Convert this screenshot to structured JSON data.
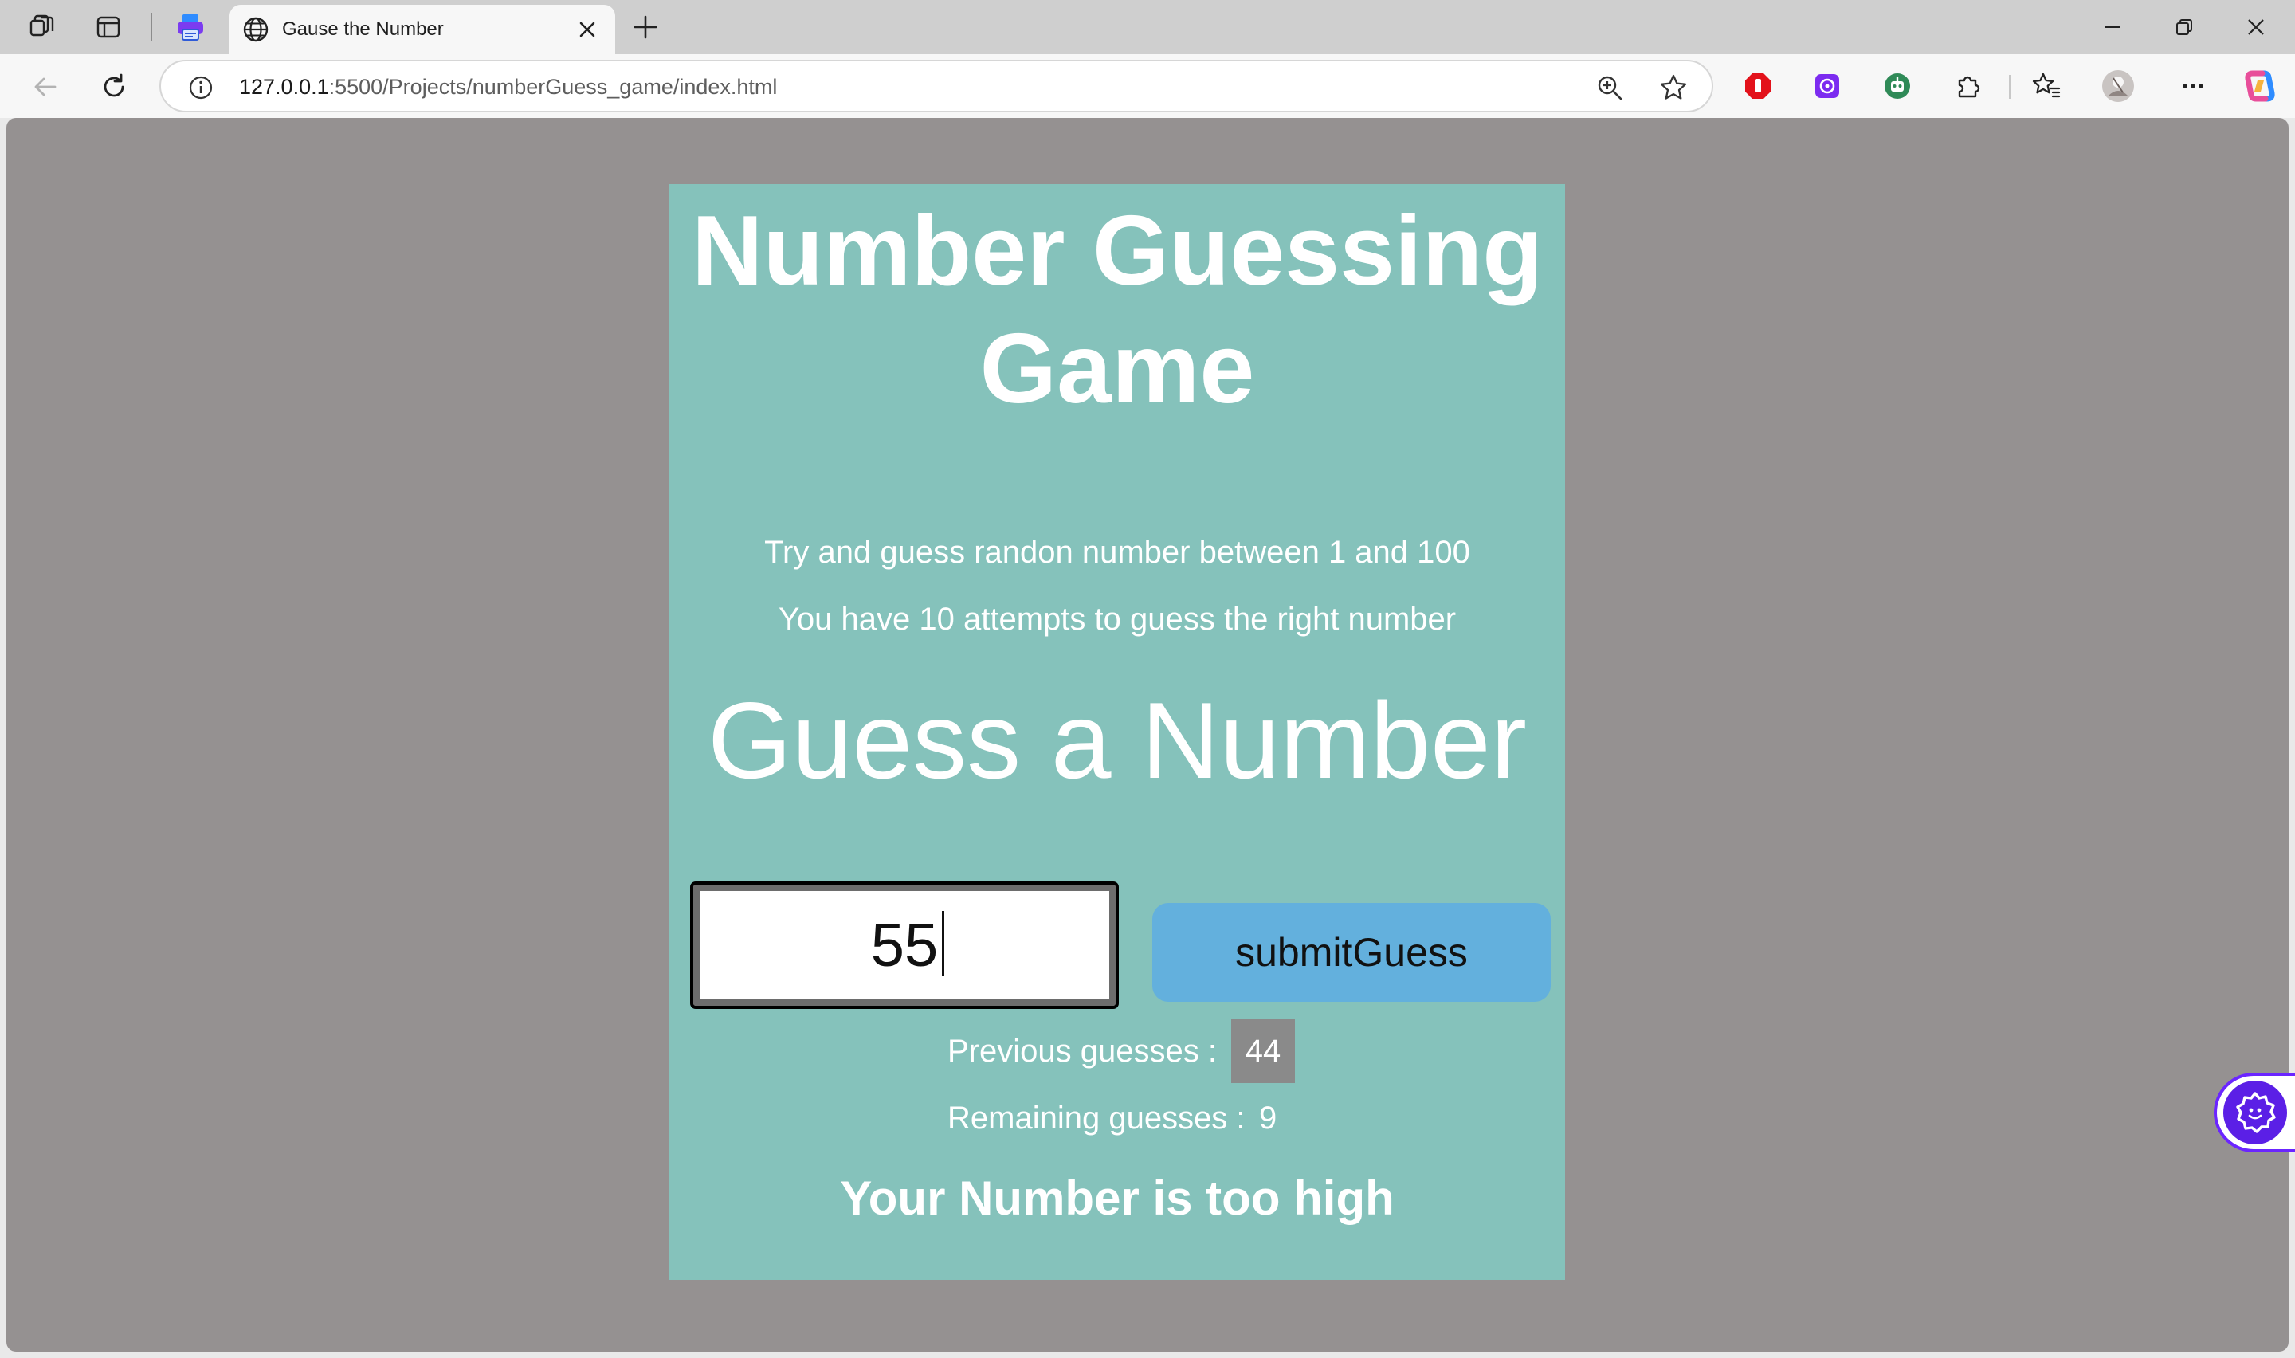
{
  "browser": {
    "tab": {
      "title": "Gause the Number"
    },
    "address_bar": {
      "url_host": "127.0.0.1",
      "url_path": ":5500/Projects/numberGuess_game/index.html"
    },
    "icons": {
      "workspaces": "workspaces-icon",
      "vertical_tabs": "vertical-tabs-icon",
      "extension_tab": "printer-extension-icon",
      "site": "globe-icon",
      "info": "info-icon",
      "zoom": "zoom-icon",
      "favorite": "star-icon",
      "adblock": "adblock-extension-icon",
      "purple_ext": "purple-extension-icon",
      "green_ext": "green-extension-icon",
      "extensions": "puzzle-icon",
      "favorites": "favorites-icon",
      "profile": "avatar",
      "more": "more-icon",
      "copilot": "copilot-icon"
    }
  },
  "page": {
    "title": "Number Guessing Game",
    "intro_line1": "Try and guess randon number between 1 and 100",
    "intro_line2": "You have 10 attempts to guess the right number",
    "prompt_heading": "Guess a Number",
    "guess_input_value": "55",
    "submit_label": "submitGuess",
    "previous_label": "Previous guesses :",
    "previous_value": "44",
    "remaining_label": "Remaining guesses :",
    "remaining_value": "9",
    "result_message": "Your Number is too high"
  },
  "colors": {
    "card": "#85c2bb",
    "page_background": "#959191",
    "button": "#63b0dd",
    "badge": "#8a8a8a",
    "helper_accent": "#6b25ff"
  }
}
